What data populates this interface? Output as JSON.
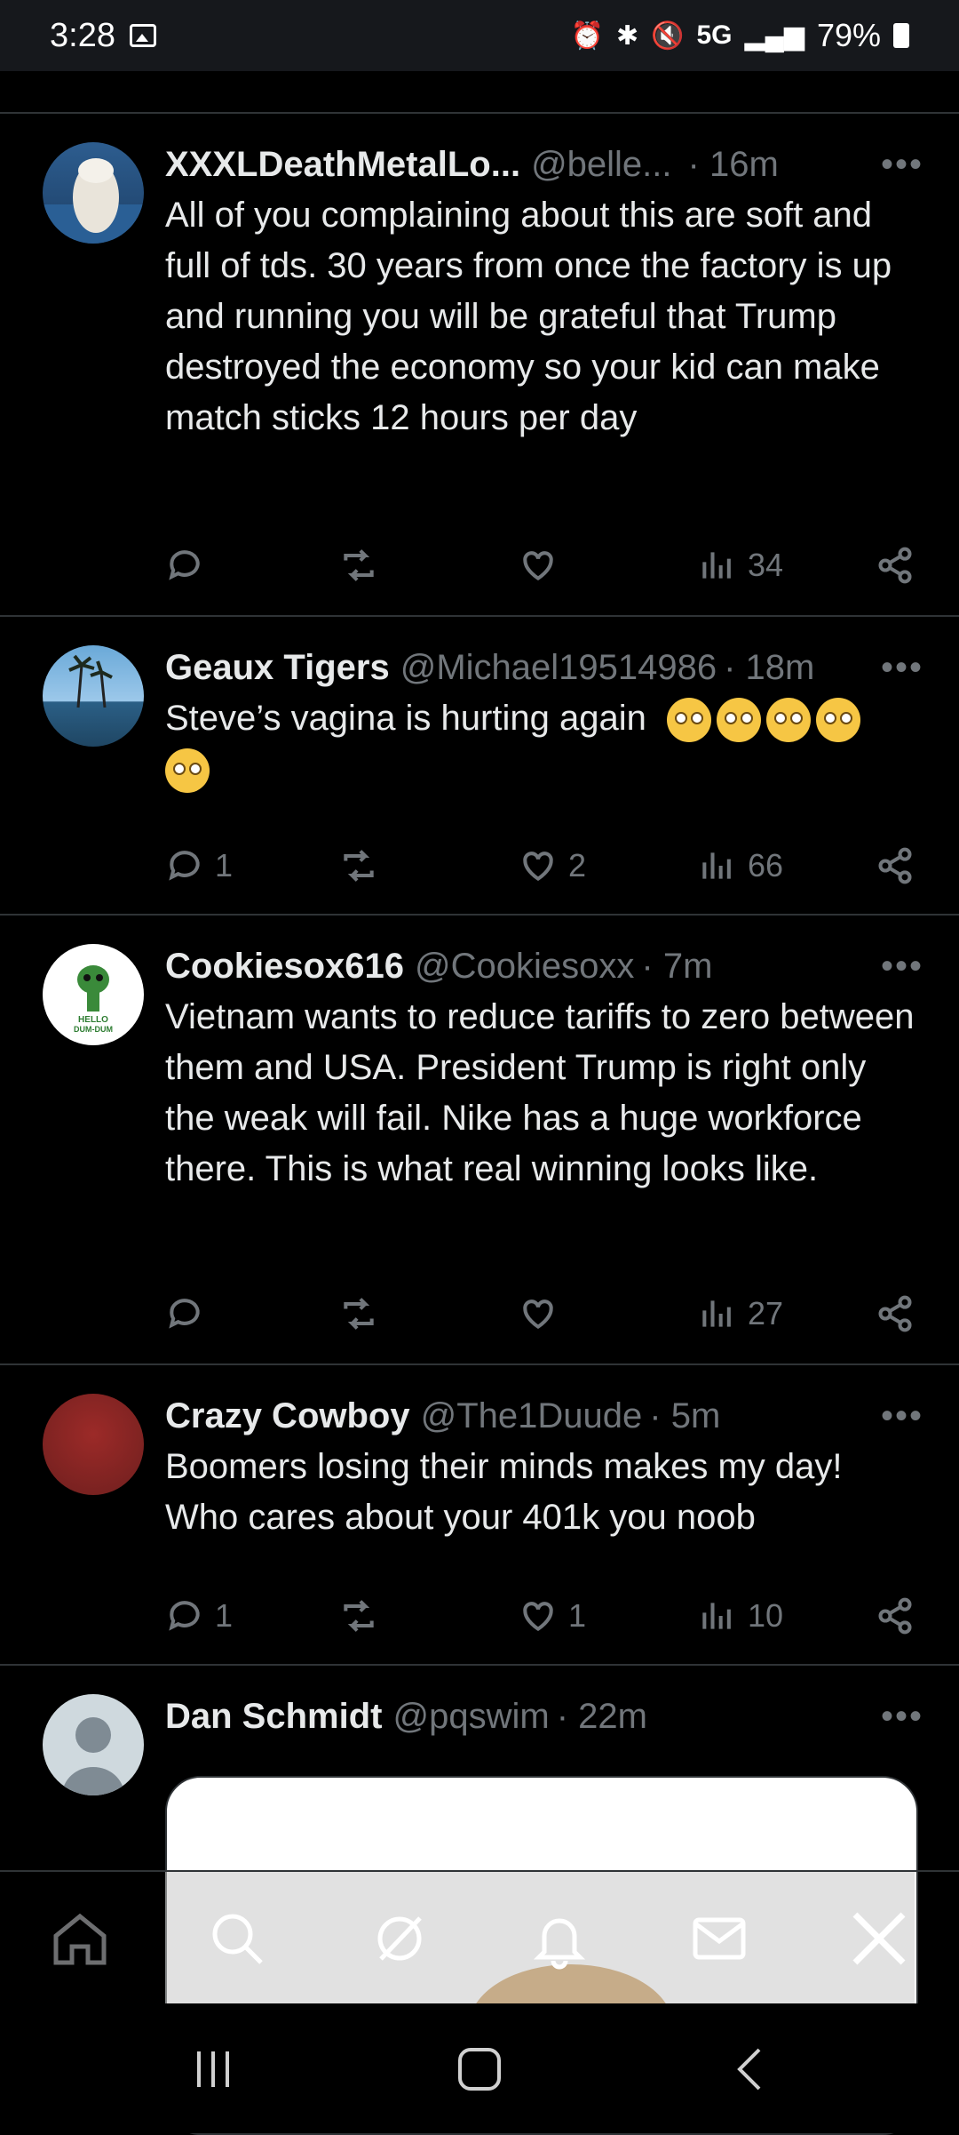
{
  "status_bar": {
    "time": "3:28",
    "network": "5G",
    "battery": "79%"
  },
  "tweets": [
    {
      "name": "XXXLDeathMetalLo...",
      "handle": "@belle...",
      "time": "· 16m",
      "text": "All of you complaining about this are soft and full of tds. 30 years from once the factory is up and running you will be grateful that Trump destroyed the economy so your kid can make match sticks 12 hours per day",
      "replies": "",
      "likes": "",
      "views": "34",
      "avatar": "beluga-whale"
    },
    {
      "name": "Geaux Tigers",
      "handle": "@Michael19514986",
      "time": "· 18m",
      "text": "Steve’s vagina is hurting again",
      "emoji_count": 5,
      "replies": "1",
      "likes": "2",
      "views": "66",
      "avatar": "palm-trees"
    },
    {
      "name": "Cookiesox616",
      "handle": "@Cookiesoxx",
      "time": "· 7m",
      "text": "Vietnam wants to reduce tariffs to zero between them and USA. President Trump is right only the weak will fail. Nike has a huge workforce there. This is what real winning looks like.",
      "replies": "",
      "likes": "",
      "views": "27",
      "avatar": "green-alien",
      "avatar_text": "HELLO DUM-DUM"
    },
    {
      "name": "Crazy Cowboy",
      "handle": "@The1Duude",
      "time": "· 5m",
      "text": "Boomers losing their minds makes my day! Who cares about your 401k you noob",
      "replies": "1",
      "likes": "1",
      "views": "10",
      "avatar": "red-blur"
    },
    {
      "name": "Dan Schmidt",
      "handle": "@pqswim",
      "time": "· 22m",
      "avatar": "default-person"
    }
  ],
  "more_glyph": "•••",
  "colors": {
    "background": "#000000",
    "text": "#e7e9ea",
    "muted": "#71767b",
    "divider": "#2f3336"
  }
}
